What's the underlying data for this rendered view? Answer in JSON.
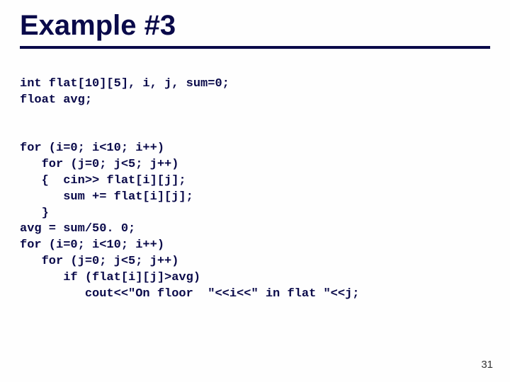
{
  "slide": {
    "title": "Example #3",
    "page_number": "31"
  },
  "code": {
    "decl1": "int flat[10][5], i, j, sum=0;",
    "decl2": "float avg;",
    "loop1_outer": "for (i=0; i<10; i++)",
    "loop1_inner": "   for (j=0; j<5; j++)",
    "loop1_brace": "   {  cin>> flat[i][j];",
    "loop1_sum": "      sum += flat[i][j];",
    "loop1_close": "   }",
    "avg_line": "avg = sum/50. 0;",
    "loop2_outer": "for (i=0; i<10; i++)",
    "loop2_inner": "   for (j=0; j<5; j++)",
    "loop2_if": "      if (flat[i][j]>avg)",
    "loop2_cout": "         cout<<\"On floor  \"<<i<<\" in flat \"<<j;"
  }
}
